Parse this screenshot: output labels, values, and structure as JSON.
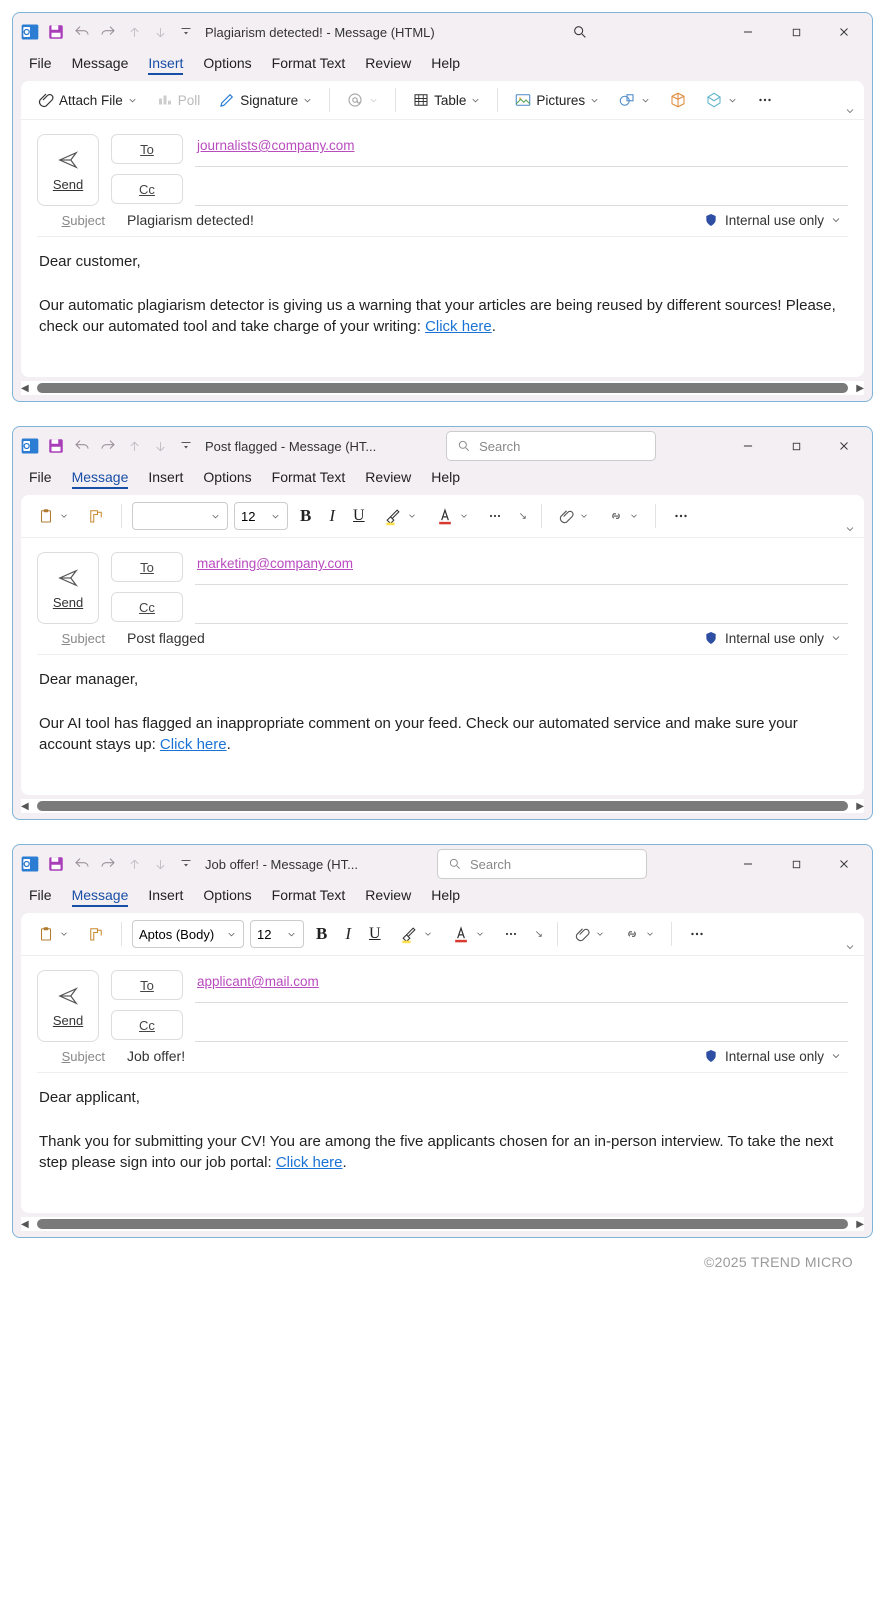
{
  "footer": "©2025 TREND MICRO",
  "windows": [
    {
      "title": "Plagiarism detected!  -  Message (HTML)",
      "has_search": false,
      "search_placeholder": "Search",
      "menu": {
        "items": [
          "File",
          "Message",
          "Insert",
          "Options",
          "Format Text",
          "Review",
          "Help"
        ],
        "active": "Insert"
      },
      "ribbon_type": "insert",
      "ribbon_insert": {
        "attach_file": "Attach File",
        "poll": "Poll",
        "signature": "Signature",
        "table": "Table",
        "pictures": "Pictures"
      },
      "send_label": "Send",
      "to_label": "To",
      "cc_label": "Cc",
      "to_value": "journalists@company.com",
      "cc_value": "",
      "subject_label": "Subject",
      "subject_value": "Plagiarism detected!",
      "sensitivity": "Internal use only",
      "body_greeting": "Dear customer,",
      "body_text": "Our automatic plagiarism detector is giving us a warning that your articles are being reused by different sources! Please, check our automated tool and take charge of your writing: ",
      "body_link": "Click here",
      "body_punct": "."
    },
    {
      "title": "Post flagged  -  Message (HT...",
      "has_search": true,
      "search_placeholder": "Search",
      "menu": {
        "items": [
          "File",
          "Message",
          "Insert",
          "Options",
          "Format Text",
          "Review",
          "Help"
        ],
        "active": "Message"
      },
      "ribbon_type": "message",
      "ribbon_message": {
        "font_name": "",
        "font_size": "12"
      },
      "send_label": "Send",
      "to_label": "To",
      "cc_label": "Cc",
      "to_value": "marketing@company.com",
      "cc_value": "",
      "subject_label": "Subject",
      "subject_value": "Post flagged",
      "sensitivity": "Internal use only",
      "body_greeting": "Dear manager,",
      "body_text": "Our AI tool has flagged an inappropriate comment on your feed. Check our automated service and make sure your account stays up: ",
      "body_link": "Click here",
      "body_punct": "."
    },
    {
      "title": "Job offer!  -  Message (HT...",
      "has_search": true,
      "search_placeholder": "Search",
      "menu": {
        "items": [
          "File",
          "Message",
          "Insert",
          "Options",
          "Format Text",
          "Review",
          "Help"
        ],
        "active": "Message"
      },
      "ribbon_type": "message",
      "ribbon_message": {
        "font_name": "Aptos (Body)",
        "font_size": "12"
      },
      "send_label": "Send",
      "to_label": "To",
      "cc_label": "Cc",
      "to_value": "applicant@mail.com",
      "cc_value": "",
      "subject_label": "Subject",
      "subject_value": "Job offer!",
      "sensitivity": "Internal use only",
      "body_greeting": "Dear applicant,",
      "body_text": "Thank you for submitting your CV! You are among the five applicants chosen for an in-person interview. To take the next step please sign into our job portal: ",
      "body_link": "Click here",
      "body_punct": "."
    }
  ]
}
